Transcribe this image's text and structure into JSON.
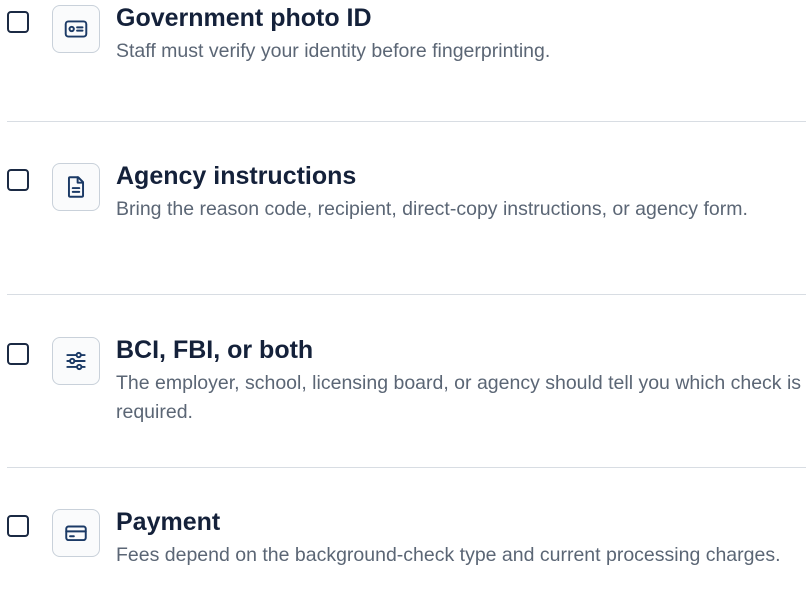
{
  "checklist": {
    "items": [
      {
        "title": "Government photo ID",
        "description": "Staff must verify your identity before fingerprinting.",
        "checked": false,
        "icon": "id-card-icon"
      },
      {
        "title": "Agency instructions",
        "description": "Bring the reason code, recipient, direct-copy instructions, or agency form.",
        "checked": false,
        "icon": "document-icon"
      },
      {
        "title": "BCI, FBI, or both",
        "description": "The employer, school, licensing board, or agency should tell you which check is required.",
        "checked": false,
        "icon": "sliders-icon"
      },
      {
        "title": "Payment",
        "description": "Fees depend on the background-check type and current processing charges.",
        "checked": false,
        "icon": "credit-card-icon"
      }
    ]
  },
  "colors": {
    "title": "#14213a",
    "description": "#5b6675",
    "icon": "#1b3a66",
    "tile_border": "#c9d1da",
    "divider": "#d8dde3"
  }
}
